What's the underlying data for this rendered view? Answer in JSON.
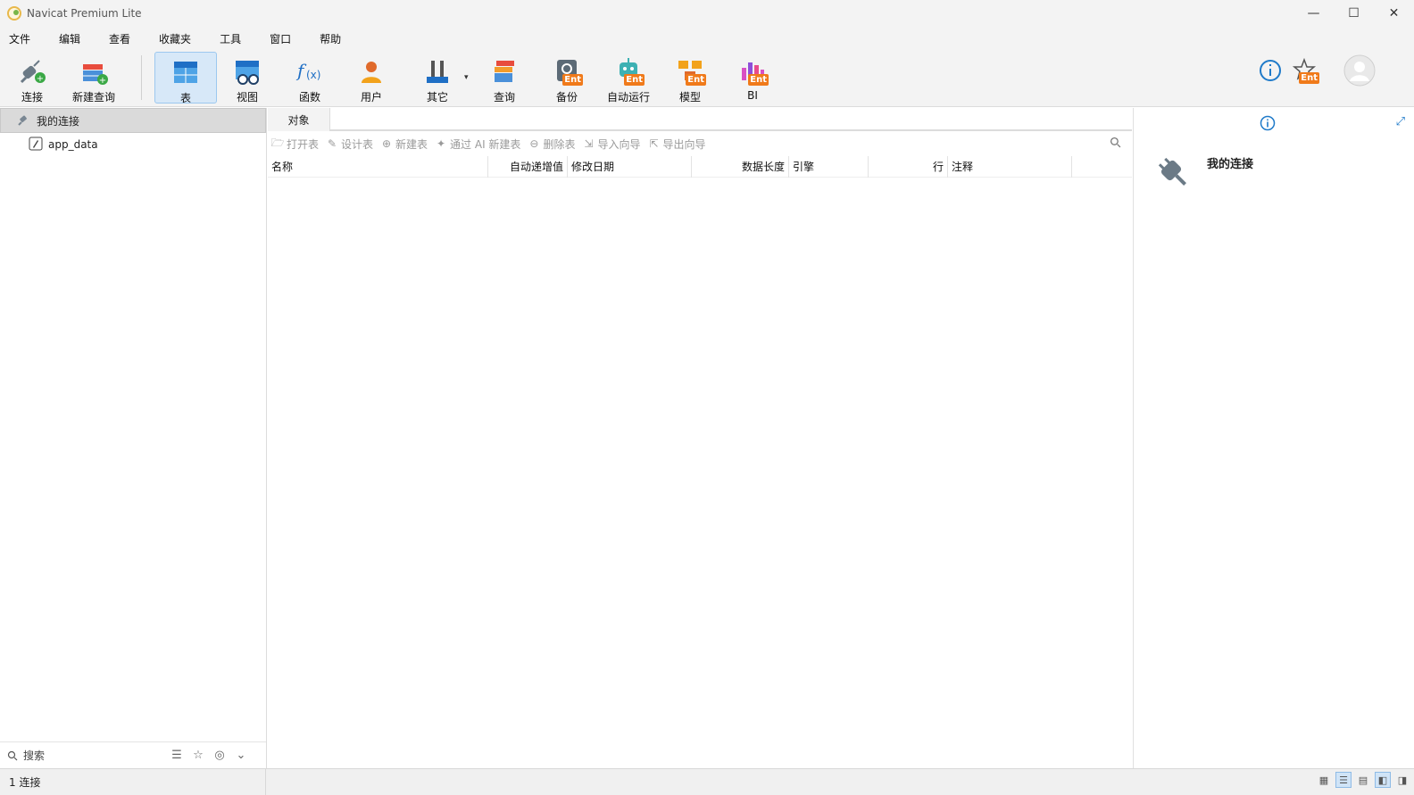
{
  "window": {
    "title": "Navicat Premium Lite",
    "minimize": "—",
    "maximize": "☐",
    "close": "✕"
  },
  "menu": [
    "文件",
    "编辑",
    "查看",
    "收藏夹",
    "工具",
    "窗口",
    "帮助"
  ],
  "toolbar": {
    "items": [
      {
        "label": "连接",
        "icon": "connection-plus-icon"
      },
      {
        "label": "新建查询",
        "icon": "new-query-icon"
      },
      {
        "label": "表",
        "icon": "table-icon",
        "active": true
      },
      {
        "label": "视图",
        "icon": "view-icon"
      },
      {
        "label": "函数",
        "icon": "function-icon"
      },
      {
        "label": "用户",
        "icon": "user-icon"
      },
      {
        "label": "其它",
        "icon": "other-tools-icon"
      },
      {
        "label": "查询",
        "icon": "query-icon"
      },
      {
        "label": "备份",
        "icon": "backup-icon",
        "badge": "Ent"
      },
      {
        "label": "自动运行",
        "icon": "automation-icon",
        "badge": "Ent"
      },
      {
        "label": "模型",
        "icon": "model-icon",
        "badge": "Ent"
      },
      {
        "label": "BI",
        "icon": "bi-icon",
        "badge": "Ent"
      }
    ],
    "right_badge": "Ent"
  },
  "left_panel": {
    "header": "我的连接",
    "tree": [
      {
        "label": "app_data",
        "icon": "sqlite-db-icon"
      }
    ],
    "search_placeholder": "搜索"
  },
  "center_panel": {
    "tab": "对象",
    "actions": [
      "打开表",
      "设计表",
      "新建表",
      "通过 AI 新建表",
      "删除表",
      "导入向导",
      "导出向导"
    ],
    "columns": [
      "名称",
      "自动递增值",
      "修改日期",
      "数据长度",
      "引擎",
      "行",
      "注释"
    ]
  },
  "right_panel": {
    "connection_name": "我的连接"
  },
  "status": {
    "text": "1 连接"
  },
  "colors": {
    "accent": "#1f7ac9",
    "ent_badge": "#f07a1a",
    "active_tool_bg": "#d7e8f8"
  }
}
